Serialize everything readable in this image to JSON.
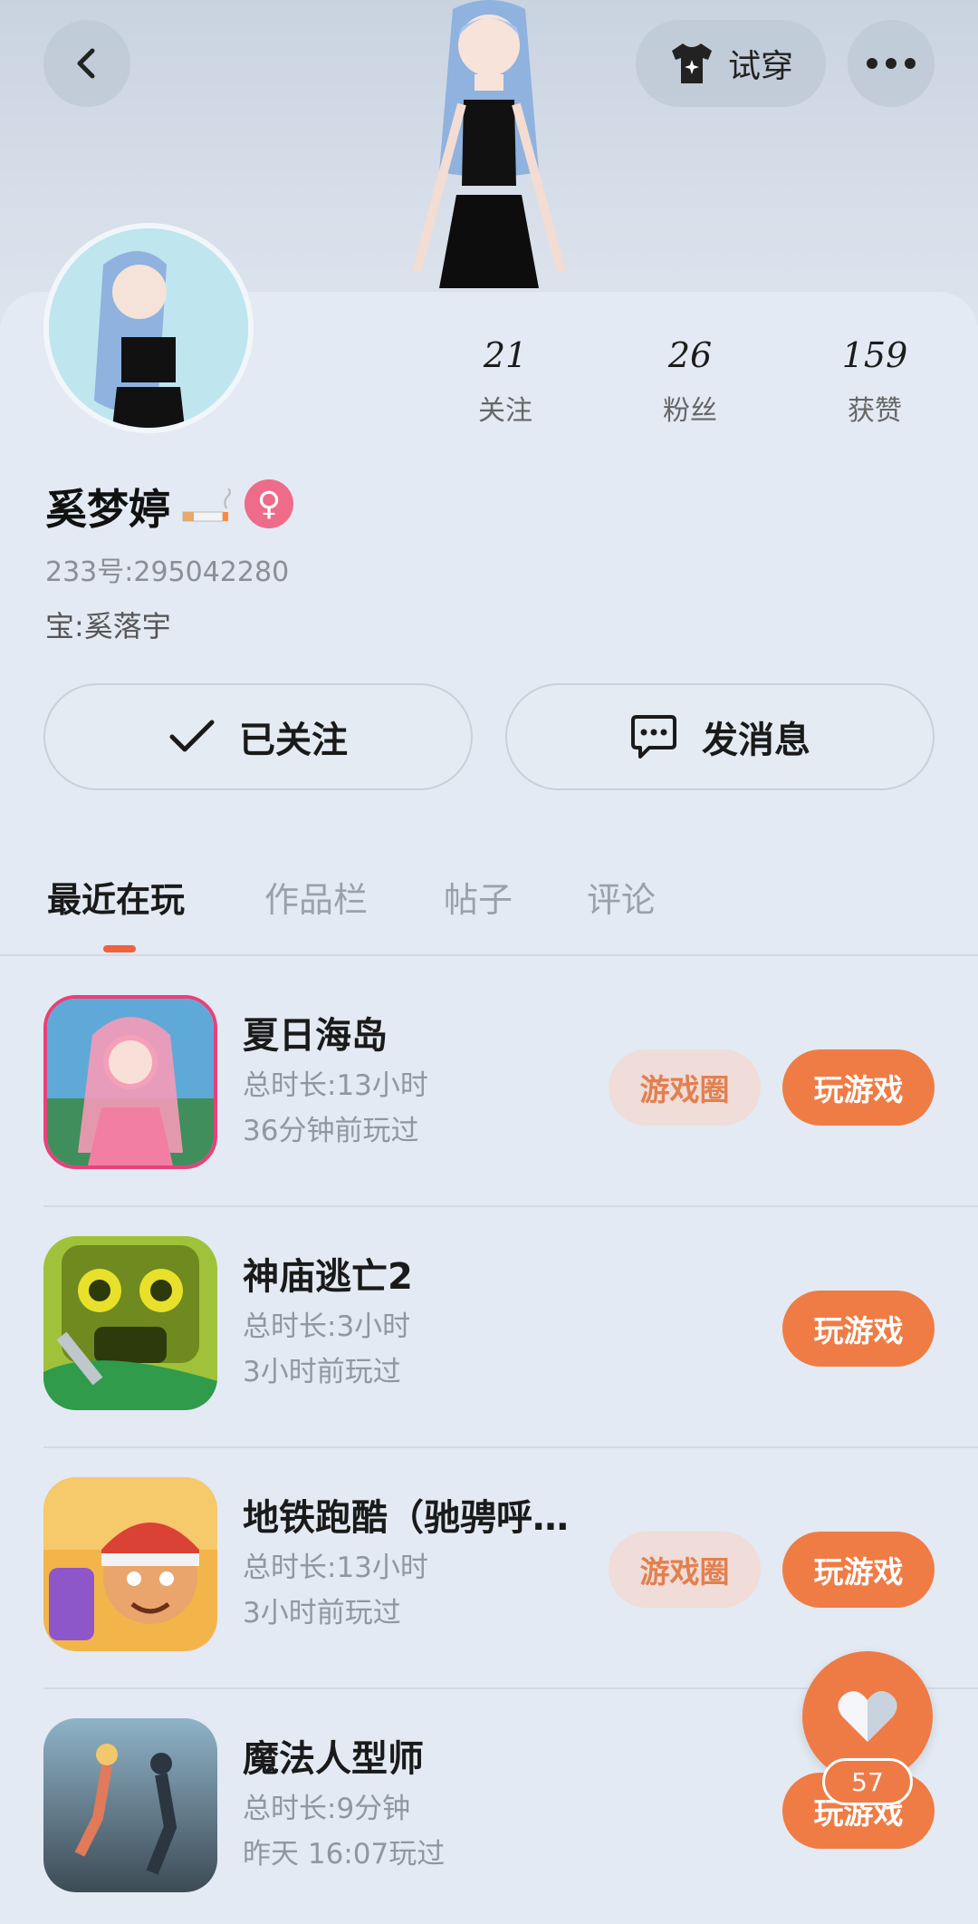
{
  "header": {
    "tryon_label": "试穿",
    "back_icon": "chevron-left-icon",
    "more_icon": "ellipsis-icon",
    "tryon_icon": "shirt-sparkle-icon"
  },
  "stats": [
    {
      "value": "21",
      "label": "关注"
    },
    {
      "value": "26",
      "label": "粉丝"
    },
    {
      "value": "159",
      "label": "获赞"
    }
  ],
  "profile": {
    "username": "奚梦婷",
    "uid": "233号:295042280",
    "bao": "宝:奚落宇",
    "gender_symbol": "♀",
    "accent_pink": "#ef6b8a"
  },
  "actions": {
    "follow_label": "已关注",
    "message_label": "发消息"
  },
  "tabs": [
    "最近在玩",
    "作品栏",
    "帖子",
    "评论"
  ],
  "games": [
    {
      "title": "夏日海岛",
      "total": "总时长:13小时",
      "last": "36分钟前玩过",
      "circle_label": "游戏圈",
      "play_label": "玩游戏"
    },
    {
      "title": "神庙逃亡2",
      "total": "总时长:3小时",
      "last": "3小时前玩过",
      "circle_label": "",
      "play_label": "玩游戏"
    },
    {
      "title": "地铁跑酷（驰骋呼…",
      "total": "总时长:13小时",
      "last": "3小时前玩过",
      "circle_label": "游戏圈",
      "play_label": "玩游戏"
    },
    {
      "title": "魔法人型师",
      "total": "总时长:9分钟",
      "last": "昨天 16:07玩过",
      "circle_label": "",
      "play_label": "玩游戏"
    }
  ],
  "fab": {
    "count": "57",
    "icon": "heart-icon"
  },
  "colors": {
    "accent_orange": "#ef7c45",
    "tab_indicator": "#f0623d"
  }
}
